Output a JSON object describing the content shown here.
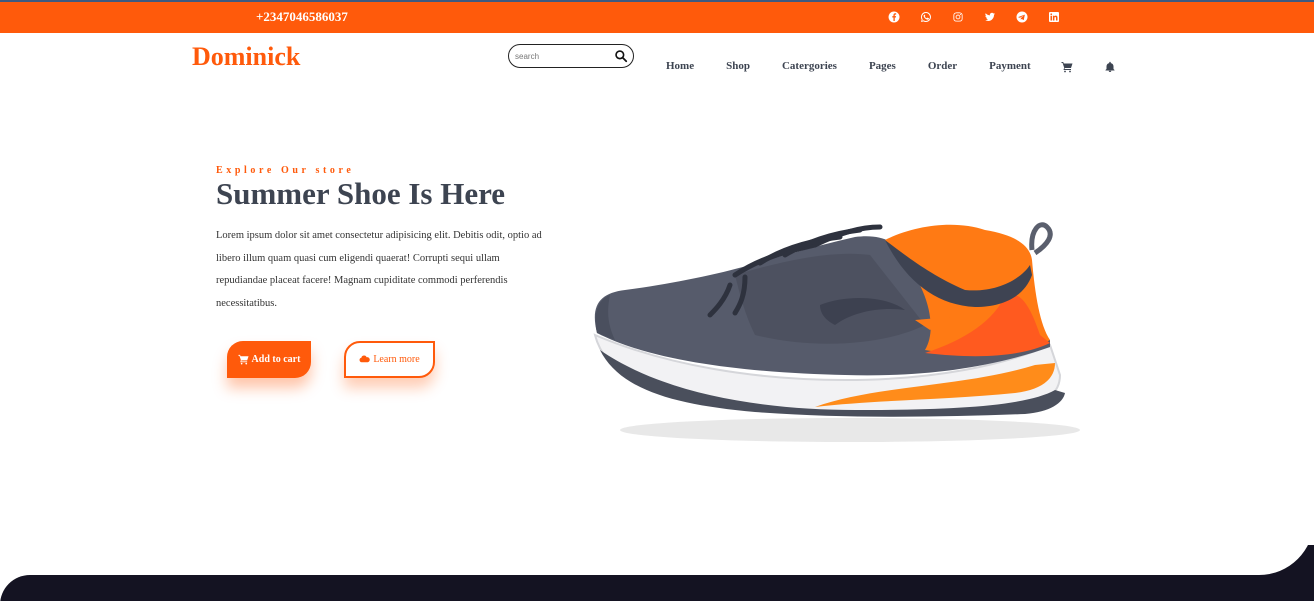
{
  "topbar": {
    "phone": "+2347046586037",
    "socials": [
      "facebook-icon",
      "whatsapp-icon",
      "instagram-icon",
      "twitter-icon",
      "telegram-icon",
      "linkedin-icon"
    ],
    "color": "#ff5a0b"
  },
  "header": {
    "logo": "Dominick",
    "search_placeholder": "search",
    "nav": {
      "home": "Home",
      "shop": "Shop",
      "categories": "Catergories",
      "pages": "Pages",
      "order": "Order",
      "payment": "Payment"
    },
    "icons": [
      "cart-icon",
      "bell-icon"
    ]
  },
  "hero": {
    "eyebrow": "Explore Our store",
    "title": "Summer Shoe Is Here",
    "description": "Lorem ipsum dolor sit amet consectetur adipisicing elit. Debitis odit, optio ad libero illum quam quasi cum eligendi quaerat! Corrupti sequi ullam repudiandae placeat facere! Magnam cupiditate commodi perferendis necessitatibus.",
    "add_to_cart": "Add to cart",
    "learn_more": "Learn more"
  },
  "colors": {
    "accent": "#ff5a0b",
    "text": "#3d4451",
    "dark": "#141322"
  }
}
